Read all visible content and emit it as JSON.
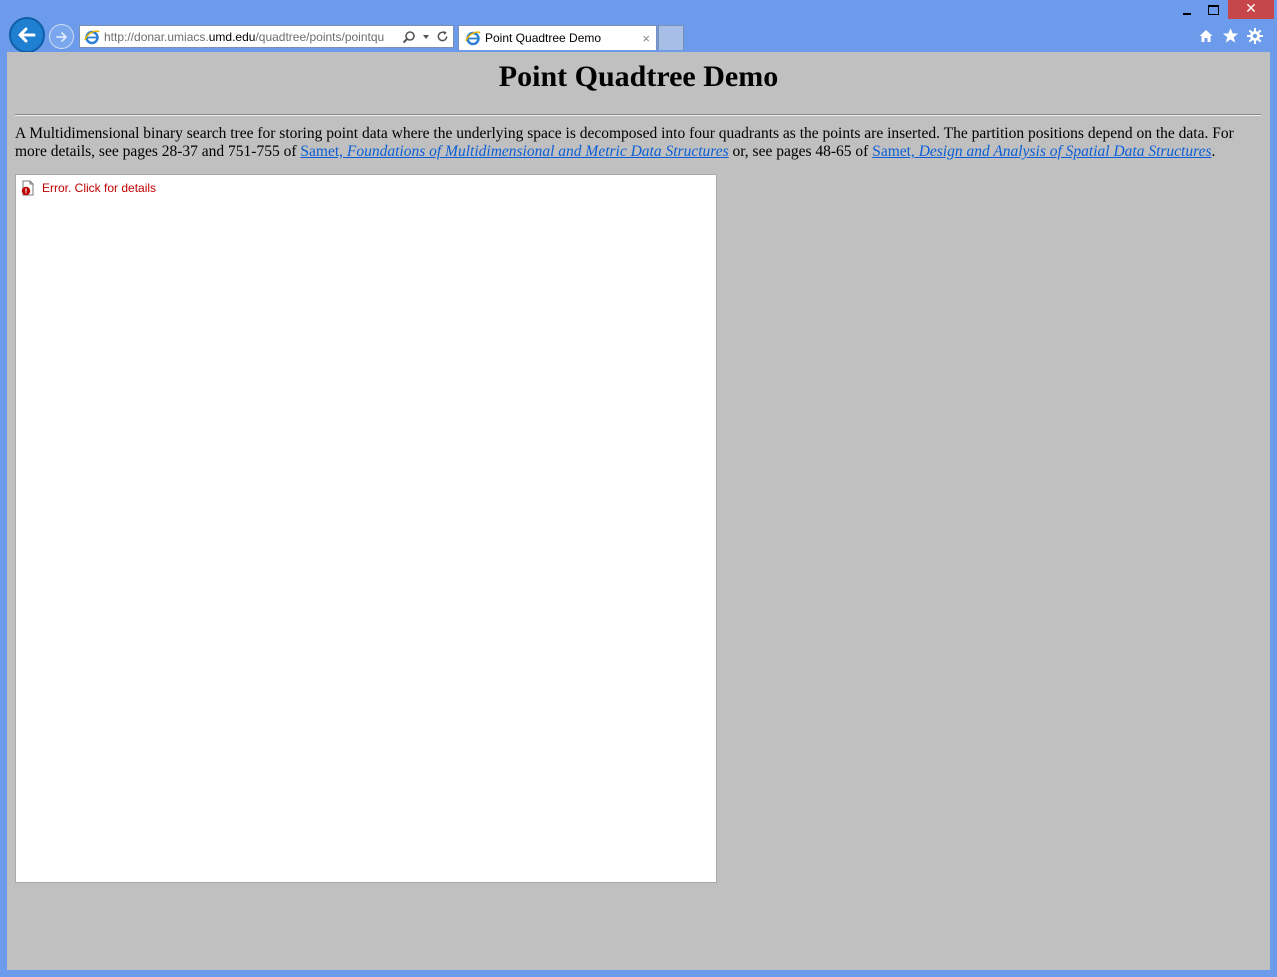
{
  "window": {
    "minimize": "–",
    "maximize": "",
    "close": "✕"
  },
  "address_bar": {
    "url_prefix": "http://donar.umiacs.",
    "url_domain": "umd.edu",
    "url_suffix": "/quadtree/points/pointqu"
  },
  "tab": {
    "title": "Point Quadtree Demo",
    "close": "×"
  },
  "page": {
    "title": "Point Quadtree Demo",
    "description_1": "A Multidimensional binary search tree for storing point data where the underlying space is decomposed into four quadrants as the points are inserted. The partition positions depend on the data. For more details, see pages 28-37 and 751-755 of ",
    "link1_author": "Samet, ",
    "link1_title": "Foundations of Multidimensional and Metric Data Structures",
    "description_2": " or, see pages 48-65 of ",
    "link2_author": "Samet, ",
    "link2_title": "Design and Analysis of Spatial Data Structures",
    "description_3": "."
  },
  "applet": {
    "error_message": "Error. Click for details"
  },
  "colors": {
    "chrome": "#6b9bea",
    "page_background": "#c0c0c0",
    "link": "#0b5ed7",
    "error": "#c00000",
    "close_button": "#c7464a"
  }
}
